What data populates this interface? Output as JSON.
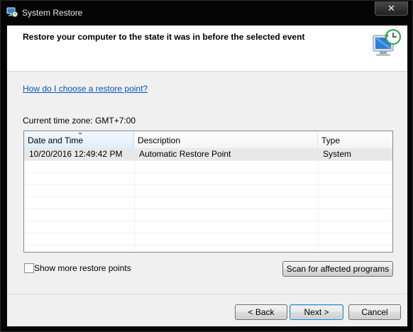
{
  "window": {
    "title": "System Restore",
    "close_label": "✕"
  },
  "banner": {
    "heading": "Restore your computer to the state it was in before the selected event"
  },
  "help_link": "How do I choose a restore point?",
  "timezone": "Current time zone: GMT+7:00",
  "table": {
    "columns": [
      "Date and Time",
      "Description",
      "Type"
    ],
    "sorted_column": "Date and Time",
    "rows": [
      {
        "date": "10/20/2016 12:49:42 PM",
        "description": "Automatic Restore Point",
        "type": "System"
      }
    ]
  },
  "show_more": {
    "label": "Show more restore points",
    "checked": false
  },
  "buttons": {
    "scan": "Scan for affected programs",
    "back": "< Back",
    "next": "Next >",
    "cancel": "Cancel"
  },
  "colors": {
    "link": "#0a56b8",
    "title_bar": "#050505",
    "selected_row": "#e8e8e8"
  },
  "icons": {
    "app": "system-restore-icon",
    "banner": "restore-computer-clock-icon"
  }
}
